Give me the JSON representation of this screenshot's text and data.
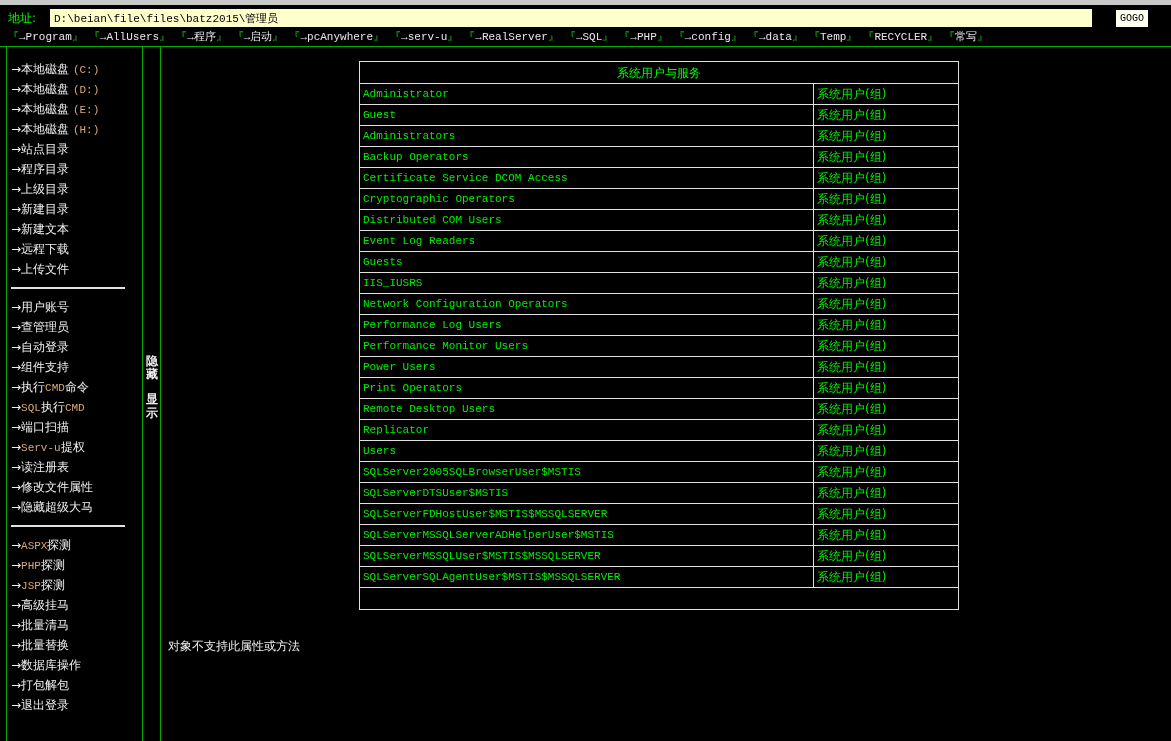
{
  "address": {
    "label": "地址:",
    "value": "D:\\beian\\file\\files\\batz2015\\管理员",
    "button": "GOGO"
  },
  "nav": [
    {
      "left": "『",
      "text": "→Program",
      "right": "』"
    },
    {
      "left": "『",
      "text": "→AllUsers",
      "right": "』"
    },
    {
      "left": "『",
      "text": "→程序",
      "right": "』"
    },
    {
      "left": "『",
      "text": "→启动",
      "right": "』"
    },
    {
      "left": "『",
      "text": "→pcAnywhere",
      "right": "』"
    },
    {
      "left": "『",
      "text": "→serv-u",
      "right": "』"
    },
    {
      "left": "『",
      "text": "→RealServer",
      "right": "』"
    },
    {
      "left": "『",
      "text": "→SQL",
      "right": "』"
    },
    {
      "left": "『",
      "text": "→PHP",
      "right": "』"
    },
    {
      "left": "『",
      "text": "→config",
      "right": "』"
    },
    {
      "left": "『",
      "text": "→data",
      "right": "』"
    },
    {
      "left": "『",
      "text": "Temp",
      "right": "』"
    },
    {
      "left": "『",
      "text": "RECYCLER",
      "right": "』"
    },
    {
      "left": "『",
      "text": "常写",
      "right": "』"
    }
  ],
  "sidebar": [
    {
      "items": [
        {
          "parts": [
            {
              "text": "→本地磁盘 ",
              "accent": false
            },
            {
              "text": "(C:)",
              "accent": true
            }
          ]
        },
        {
          "parts": [
            {
              "text": "→本地磁盘 ",
              "accent": false
            },
            {
              "text": "(D:)",
              "accent": true
            }
          ]
        },
        {
          "parts": [
            {
              "text": "→本地磁盘 ",
              "accent": false
            },
            {
              "text": "(E:)",
              "accent": true
            }
          ]
        },
        {
          "parts": [
            {
              "text": "→本地磁盘 ",
              "accent": false
            },
            {
              "text": "(H:)",
              "accent": true
            }
          ]
        },
        {
          "parts": [
            {
              "text": "→站点目录",
              "accent": false
            }
          ]
        },
        {
          "parts": [
            {
              "text": "→程序目录",
              "accent": false
            }
          ]
        },
        {
          "parts": [
            {
              "text": "→上级目录",
              "accent": false
            }
          ]
        },
        {
          "parts": [
            {
              "text": "→新建目录",
              "accent": false
            }
          ]
        },
        {
          "parts": [
            {
              "text": "→新建文本",
              "accent": false
            }
          ]
        },
        {
          "parts": [
            {
              "text": "→远程下载",
              "accent": false
            }
          ]
        },
        {
          "parts": [
            {
              "text": "→上传文件",
              "accent": false
            }
          ]
        }
      ]
    },
    {
      "items": [
        {
          "parts": [
            {
              "text": "→用户账号",
              "accent": false
            }
          ]
        },
        {
          "parts": [
            {
              "text": "→查管理员",
              "accent": false
            }
          ]
        },
        {
          "parts": [
            {
              "text": "→自动登录",
              "accent": false
            }
          ]
        },
        {
          "parts": [
            {
              "text": "→组件支持",
              "accent": false
            }
          ]
        },
        {
          "parts": [
            {
              "text": "→执行",
              "accent": false
            },
            {
              "text": "CMD",
              "accent": true
            },
            {
              "text": "命令",
              "accent": false
            }
          ]
        },
        {
          "parts": [
            {
              "text": "→",
              "accent": false
            },
            {
              "text": "SQL",
              "accent": true
            },
            {
              "text": "执行",
              "accent": false
            },
            {
              "text": "CMD",
              "accent": true
            }
          ]
        },
        {
          "parts": [
            {
              "text": "→端口扫描",
              "accent": false
            }
          ]
        },
        {
          "parts": [
            {
              "text": "→",
              "accent": false
            },
            {
              "text": "Serv-u",
              "accent": true
            },
            {
              "text": "提权",
              "accent": false
            }
          ]
        },
        {
          "parts": [
            {
              "text": "→读注册表",
              "accent": false
            }
          ]
        },
        {
          "parts": [
            {
              "text": "→修改文件属性",
              "accent": false
            }
          ]
        },
        {
          "parts": [
            {
              "text": "→隐藏超级大马",
              "accent": false
            }
          ]
        }
      ]
    },
    {
      "items": [
        {
          "parts": [
            {
              "text": "→",
              "accent": false
            },
            {
              "text": "ASPX",
              "accent": true
            },
            {
              "text": "探测",
              "accent": false
            }
          ]
        },
        {
          "parts": [
            {
              "text": "→",
              "accent": false
            },
            {
              "text": "PHP",
              "accent": true
            },
            {
              "text": "探测",
              "accent": false
            }
          ]
        },
        {
          "parts": [
            {
              "text": "→",
              "accent": false
            },
            {
              "text": "JSP",
              "accent": true
            },
            {
              "text": "探测",
              "accent": false
            }
          ]
        },
        {
          "parts": [
            {
              "text": "→高级挂马",
              "accent": false
            }
          ]
        },
        {
          "parts": [
            {
              "text": "→批量清马",
              "accent": false
            }
          ]
        },
        {
          "parts": [
            {
              "text": "→批量替换",
              "accent": false
            }
          ]
        },
        {
          "parts": [
            {
              "text": "→数据库操作",
              "accent": false
            }
          ]
        },
        {
          "parts": [
            {
              "text": "→打包解包",
              "accent": false
            }
          ]
        },
        {
          "parts": [
            {
              "text": "→退出登录",
              "accent": false
            }
          ]
        }
      ]
    }
  ],
  "toggles": [
    "隐藏",
    "显示"
  ],
  "table": {
    "title": "系统用户与服务",
    "rows": [
      [
        "Administrator",
        "系统用户(组)"
      ],
      [
        "Guest",
        "系统用户(组)"
      ],
      [
        "Administrators",
        "系统用户(组)"
      ],
      [
        "Backup Operators",
        "系统用户(组)"
      ],
      [
        "Certificate Service DCOM Access",
        "系统用户(组)"
      ],
      [
        "Cryptographic Operators",
        "系统用户(组)"
      ],
      [
        "Distributed COM Users",
        "系统用户(组)"
      ],
      [
        "Event Log Readers",
        "系统用户(组)"
      ],
      [
        "Guests",
        "系统用户(组)"
      ],
      [
        "IIS_IUSRS",
        "系统用户(组)"
      ],
      [
        "Network Configuration Operators",
        "系统用户(组)"
      ],
      [
        "Performance Log Users",
        "系统用户(组)"
      ],
      [
        "Performance Monitor Users",
        "系统用户(组)"
      ],
      [
        "Power Users",
        "系统用户(组)"
      ],
      [
        "Print Operators",
        "系统用户(组)"
      ],
      [
        "Remote Desktop Users",
        "系统用户(组)"
      ],
      [
        "Replicator",
        "系统用户(组)"
      ],
      [
        "Users",
        "系统用户(组)"
      ],
      [
        "SQLServer2005SQLBrowserUser$MSTIS",
        "系统用户(组)"
      ],
      [
        "SQLServerDTSUser$MSTIS",
        "系统用户(组)"
      ],
      [
        "SQLServerFDHostUser$MSTIS$MSSQLSERVER",
        "系统用户(组)"
      ],
      [
        "SQLServerMSSQLServerADHelperUser$MSTIS",
        "系统用户(组)"
      ],
      [
        "SQLServerMSSQLUser$MSTIS$MSSQLSERVER",
        "系统用户(组)"
      ],
      [
        "SQLServerSQLAgentUser$MSTIS$MSSQLSERVER",
        "系统用户(组)"
      ]
    ]
  },
  "message": "对象不支持此属性或方法"
}
